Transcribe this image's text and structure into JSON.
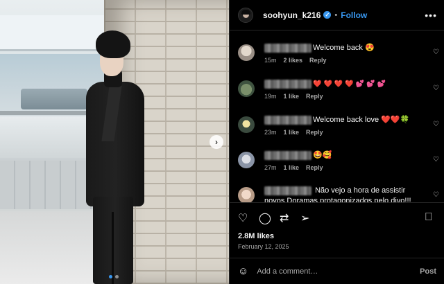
{
  "post": {
    "username": "soohyun_k216",
    "verified_icon": "verified-badge-icon",
    "separator": "•",
    "follow_label": "Follow",
    "more_label": "•••"
  },
  "media": {
    "image_icon": "photo",
    "next_label": "›",
    "carousel_dots": 2,
    "active_dot": 1
  },
  "comments": [
    {
      "text": "Welcome back 😍",
      "time": "15m",
      "likes": "2 likes",
      "reply": "Reply"
    },
    {
      "text": "❤️❤️❤️❤️💕💕💕",
      "time": "19m",
      "likes": "1 like",
      "reply": "Reply"
    },
    {
      "text": "Welcome back love ❤️❤️🍀",
      "time": "23m",
      "likes": "1 like",
      "reply": "Reply"
    },
    {
      "text": "🤩🥰",
      "time": "27m",
      "likes": "1 like",
      "reply": "Reply"
    },
    {
      "text": "Não vejo a hora de assistir novos Doramas protagonizados pelo divo!!! Justiça",
      "time": "",
      "likes": "",
      "reply": ""
    }
  ],
  "actions": {
    "like_icon": "heart-icon",
    "comment_icon": "comment-icon",
    "repost_icon": "repost-icon",
    "share_icon": "share-icon",
    "save_icon": "bookmark-icon"
  },
  "likes": "2.8M likes",
  "date": "February 12, 2025",
  "compose": {
    "placeholder": "Add a comment…",
    "post_label": "Post"
  },
  "colors": {
    "accent": "#3897f0",
    "heart": "#ed4956",
    "background": "#000000",
    "muted_text": "#a8a8a8"
  }
}
